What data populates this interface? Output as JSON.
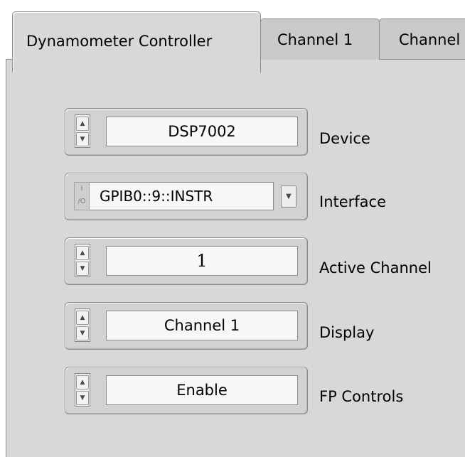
{
  "tabs": [
    {
      "label": "Dynamometer Controller",
      "active": true
    },
    {
      "label": "Channel 1",
      "active": false
    },
    {
      "label": "Channel",
      "active": false
    }
  ],
  "controls": {
    "device": {
      "value": "DSP7002",
      "label": "Device"
    },
    "interface": {
      "value": "GPIB0::9::INSTR",
      "label": "Interface",
      "icon": "visa-resource-icon"
    },
    "active_channel": {
      "value": "1",
      "label": "Active Channel"
    },
    "display": {
      "value": "Channel 1",
      "label": "Display"
    },
    "fp_controls": {
      "value": "Enable",
      "label": "FP Controls"
    }
  },
  "colors": {
    "panel": "#d8d8d8",
    "field": "#f7f7f7",
    "border": "#8a8a8a"
  }
}
